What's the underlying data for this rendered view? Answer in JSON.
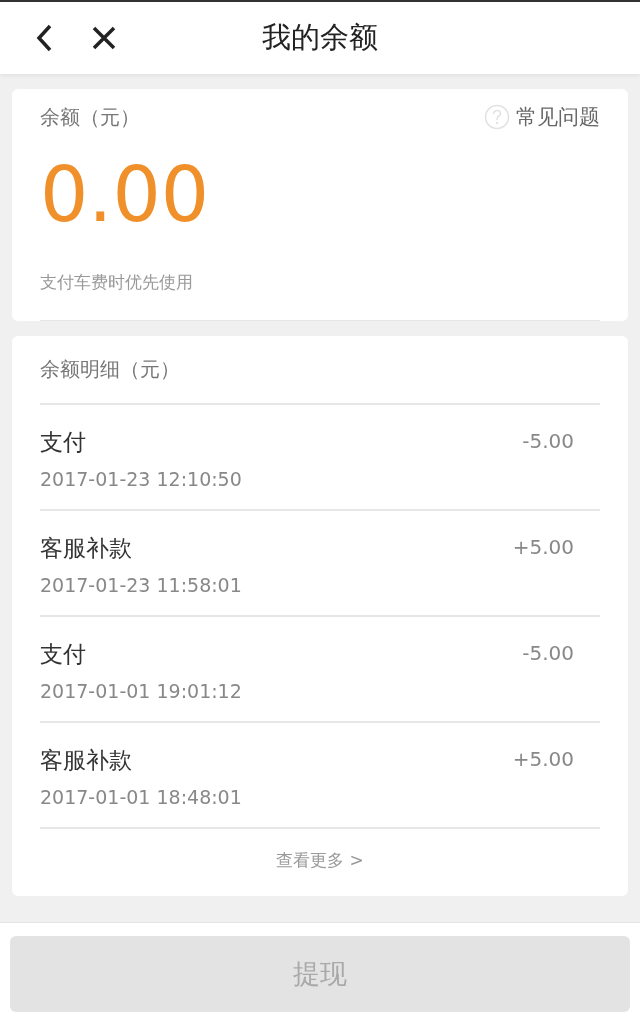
{
  "header": {
    "title": "我的余额"
  },
  "balance": {
    "label": "余额（元）",
    "help": "常见问题",
    "amount": "0.00",
    "note": "支付车费时优先使用"
  },
  "details": {
    "title": "余额明细（元）",
    "rows": [
      {
        "name": "支付",
        "time": "2017-01-23 12:10:50",
        "amount": "-5.00"
      },
      {
        "name": "客服补款",
        "time": "2017-01-23 11:58:01",
        "amount": "+5.00"
      },
      {
        "name": "支付",
        "time": "2017-01-01 19:01:12",
        "amount": "-5.00"
      },
      {
        "name": "客服补款",
        "time": "2017-01-01 18:48:01",
        "amount": "+5.00"
      }
    ],
    "more": "查看更多 >"
  },
  "withdraw_button": {
    "label": "提现",
    "disabled": true
  }
}
